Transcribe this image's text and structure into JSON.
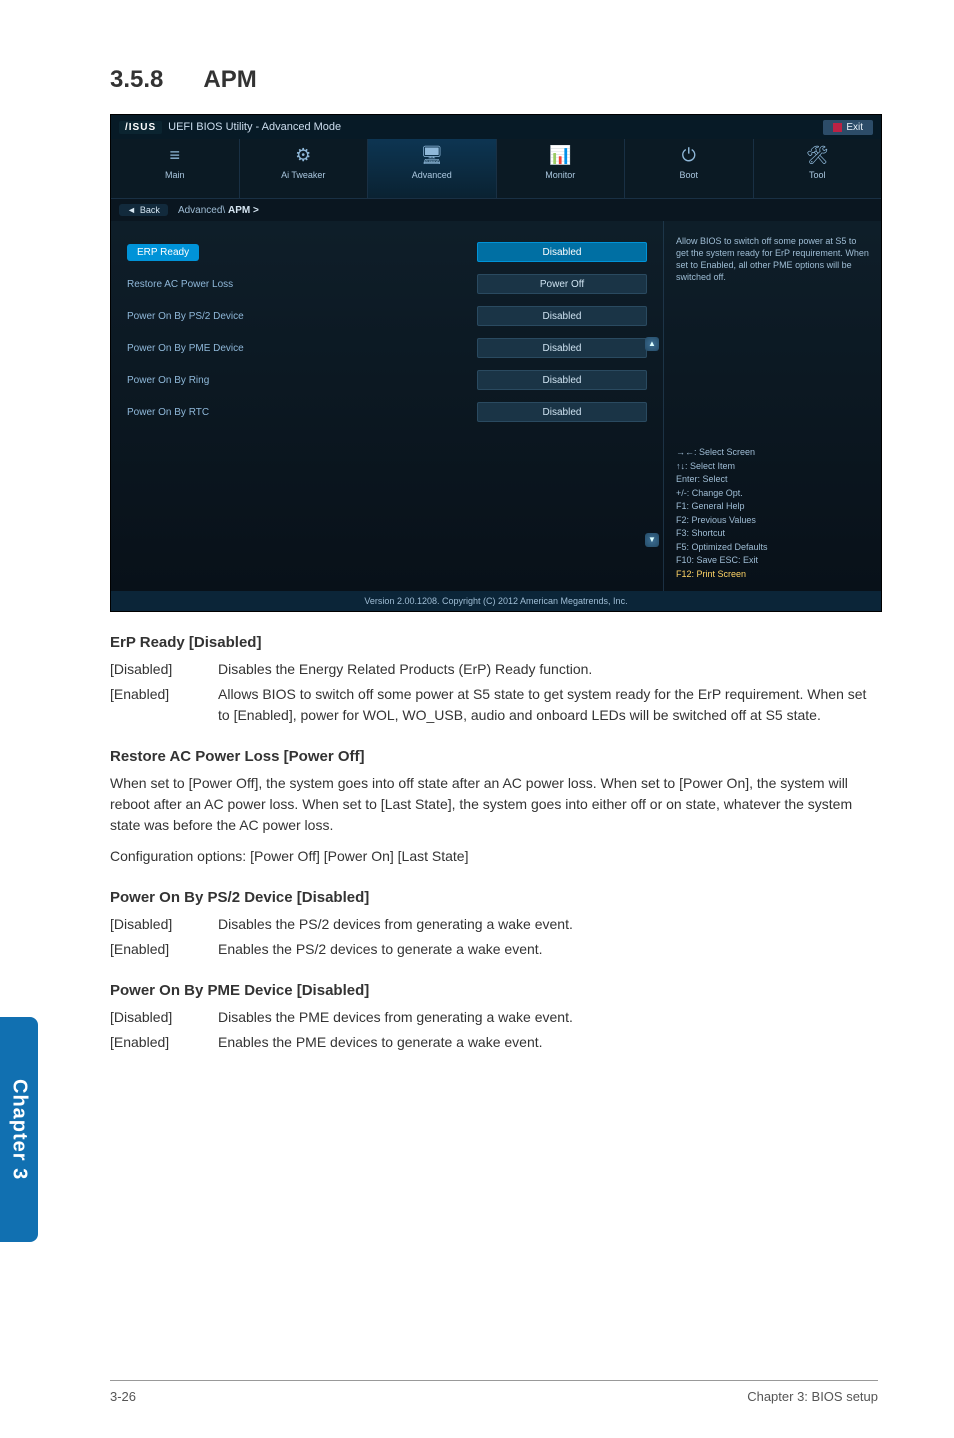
{
  "heading": {
    "number": "3.5.8",
    "title": "APM"
  },
  "bios": {
    "title_prefix": "/ISUS",
    "title": "UEFI BIOS Utility - Advanced Mode",
    "exit_label": "Exit",
    "tabs": [
      {
        "icon": "≡",
        "label": "Main"
      },
      {
        "icon": "⚙",
        "label": "Ai Tweaker"
      },
      {
        "icon": "🖥",
        "label": "Advanced"
      },
      {
        "icon": "📊",
        "label": "Monitor"
      },
      {
        "icon": "⏻",
        "label": "Boot"
      },
      {
        "icon": "🛠",
        "label": "Tool"
      }
    ],
    "breadcrumb": {
      "back": "Back",
      "path_plain": "Advanced\\ ",
      "path_bold": "APM >"
    },
    "rows": [
      {
        "label": "ERP Ready",
        "value": "Disabled",
        "selected": true
      },
      {
        "label": "Restore AC Power Loss",
        "value": "Power Off"
      },
      {
        "label": "Power On By PS/2 Device",
        "value": "Disabled"
      },
      {
        "label": "Power On By PME Device",
        "value": "Disabled"
      },
      {
        "label": "Power On By Ring",
        "value": "Disabled"
      },
      {
        "label": "Power On By RTC",
        "value": "Disabled"
      }
    ],
    "help_text": "Allow BIOS to switch off some power at S5 to get the system ready for ErP requirement. When set to Enabled, all other PME options will be switched off.",
    "help_keys": [
      "→←: Select Screen",
      "↑↓: Select Item",
      "Enter: Select",
      "+/-: Change Opt.",
      "F1: General Help",
      "F2: Previous Values",
      "F3: Shortcut",
      "F5: Optimized Defaults",
      "F10: Save   ESC: Exit"
    ],
    "help_keys_gold": "F12: Print Screen",
    "footer": "Version 2.00.1208. Copyright (C) 2012 American Megatrends, Inc."
  },
  "doc": {
    "erp": {
      "title": "ErP Ready [Disabled]",
      "rows": [
        {
          "term": "[Disabled]",
          "desc": "Disables the Energy Related Products (ErP) Ready function."
        },
        {
          "term": "[Enabled]",
          "desc": "Allows BIOS to switch off some power at S5 state to get system ready for the ErP requirement. When set to [Enabled], power for WOL, WO_USB, audio and onboard LEDs will be switched off at S5 state."
        }
      ]
    },
    "restore": {
      "title": "Restore AC Power Loss [Power Off]",
      "para1": "When set to [Power Off], the system goes into off state after an AC power loss. When set to [Power On], the system will reboot after an AC power loss. When set to [Last State], the system goes into either off or on state, whatever the system state was before the AC power loss.",
      "para2": "Configuration options: [Power Off] [Power On] [Last State]"
    },
    "ps2": {
      "title": "Power On By PS/2 Device [Disabled]",
      "rows": [
        {
          "term": "[Disabled]",
          "desc": "Disables the PS/2 devices from generating a wake event."
        },
        {
          "term": "[Enabled]",
          "desc": "Enables the PS/2 devices to generate a wake event."
        }
      ]
    },
    "pme": {
      "title": "Power On By PME Device [Disabled]",
      "rows": [
        {
          "term": "[Disabled]",
          "desc": "Disables the PME devices from generating a wake event."
        },
        {
          "term": "[Enabled]",
          "desc": "Enables the PME devices to generate a wake event."
        }
      ]
    }
  },
  "spine": "Chapter 3",
  "footer": {
    "left": "3-26",
    "right": "Chapter 3: BIOS setup"
  }
}
